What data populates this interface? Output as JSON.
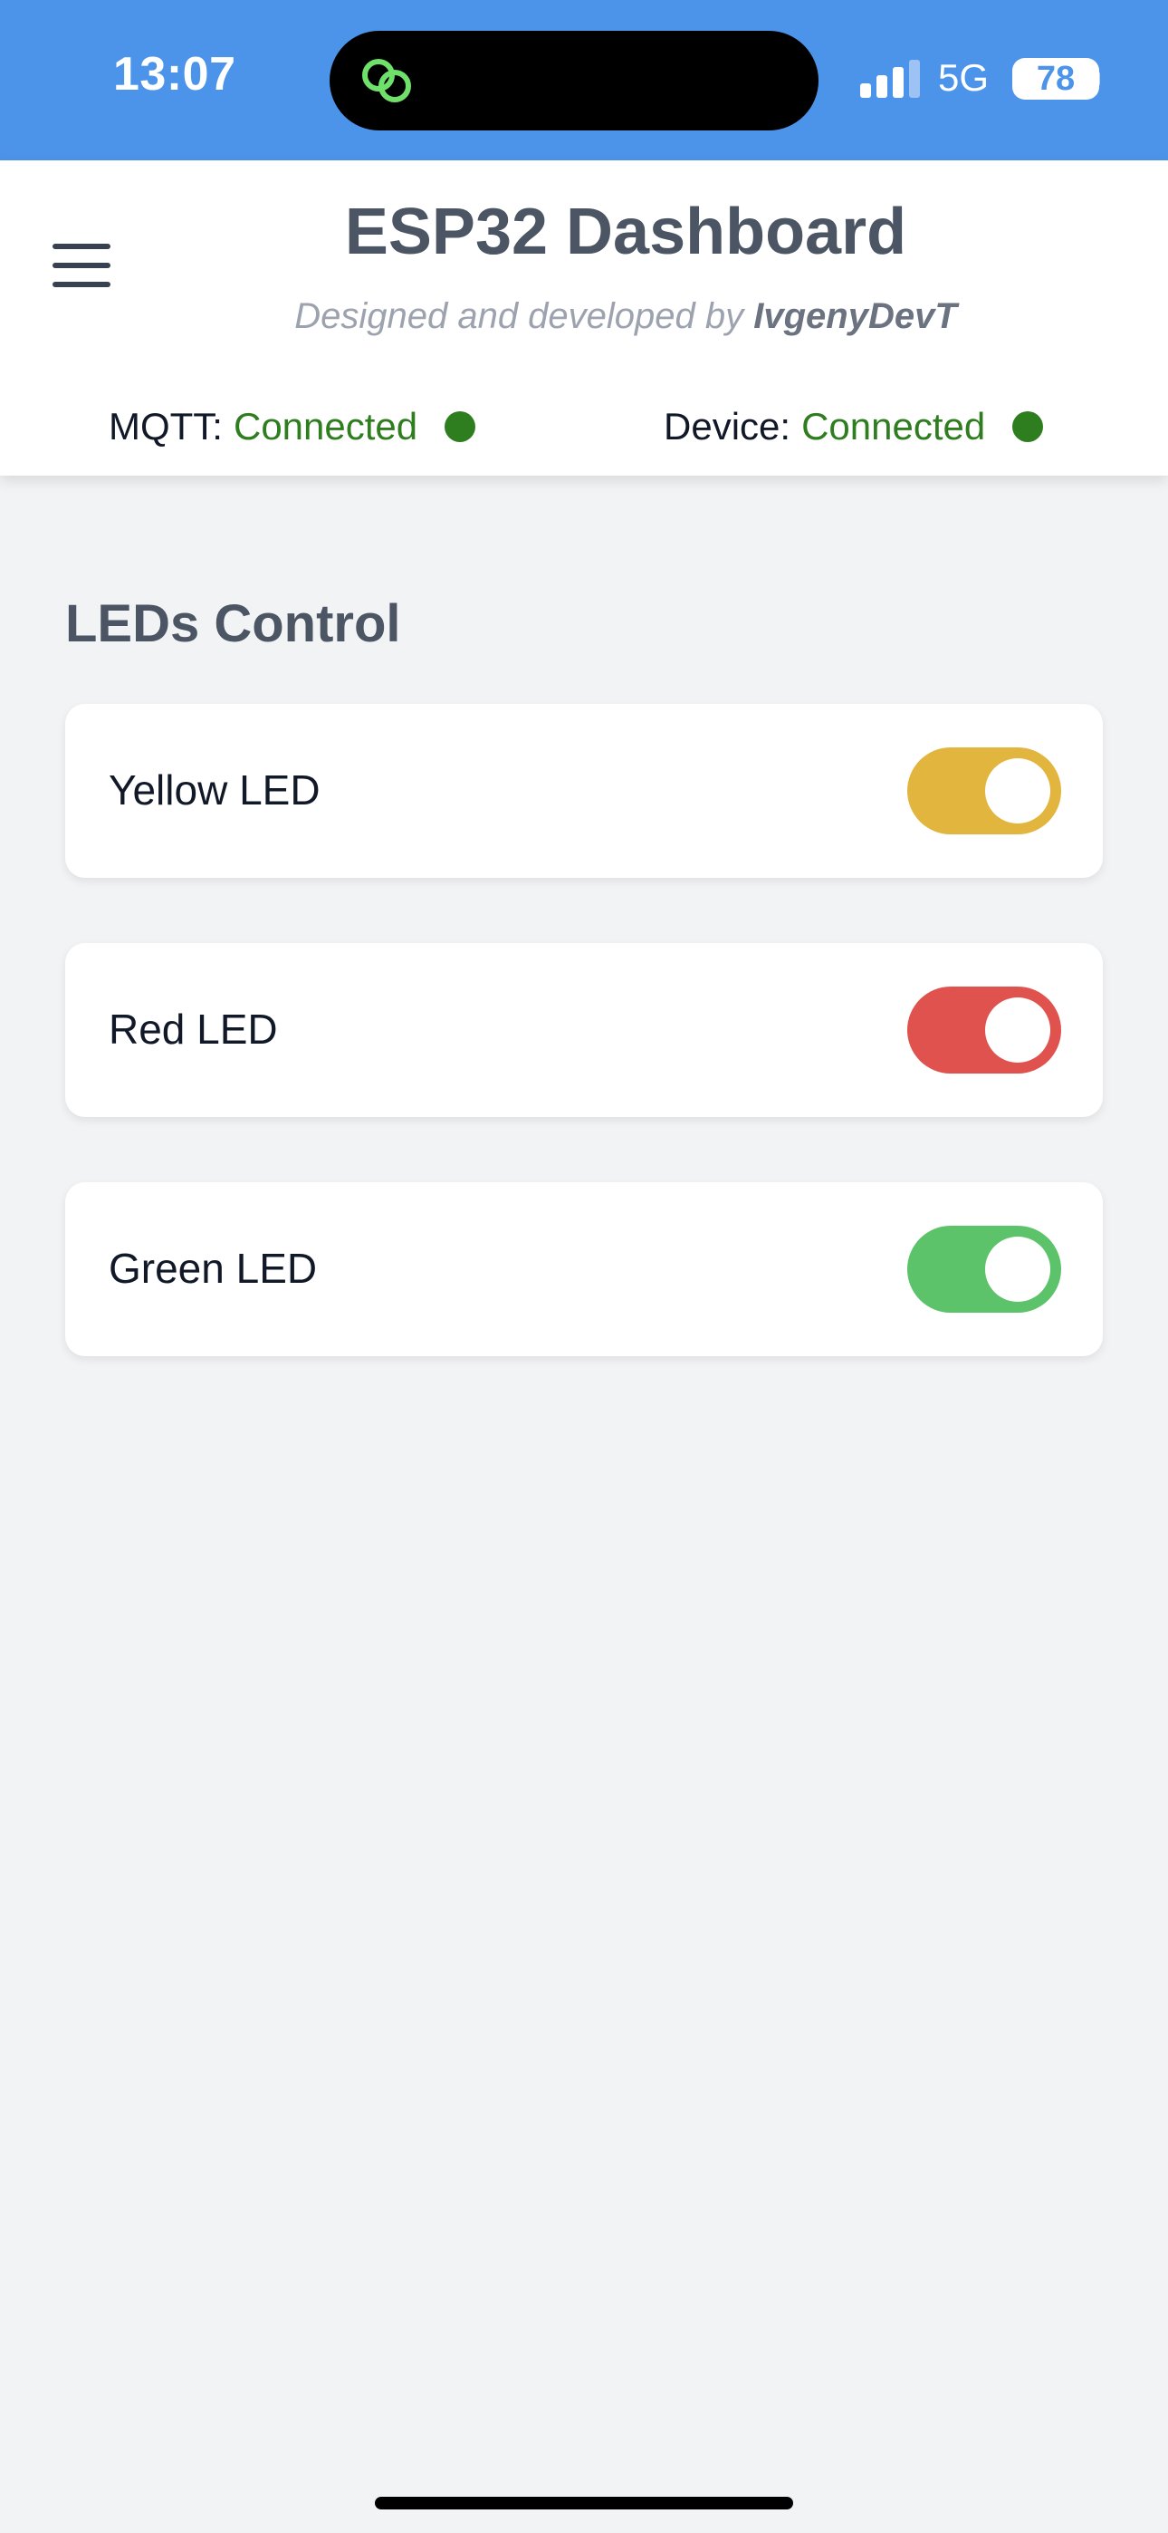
{
  "status_bar": {
    "time": "13:07",
    "network": "5G",
    "battery": "78",
    "icons": [
      "app-link-icon",
      "signal-icon"
    ]
  },
  "header": {
    "title": "ESP32 Dashboard",
    "subtitle_prefix": "Designed and developed by ",
    "subtitle_author": "IvgenyDevT",
    "menu_icon": "hamburger-menu-icon",
    "mqtt_label": "MQTT:",
    "mqtt_status": "Connected",
    "device_label": "Device:",
    "device_status": "Connected",
    "status_color": "#2e7d1e"
  },
  "main": {
    "section_title": "LEDs Control",
    "leds": [
      {
        "label": "Yellow LED",
        "on": true,
        "color": "#e2b53e"
      },
      {
        "label": "Red LED",
        "on": true,
        "color": "#e0524d"
      },
      {
        "label": "Green LED",
        "on": true,
        "color": "#5dc36a"
      }
    ]
  }
}
